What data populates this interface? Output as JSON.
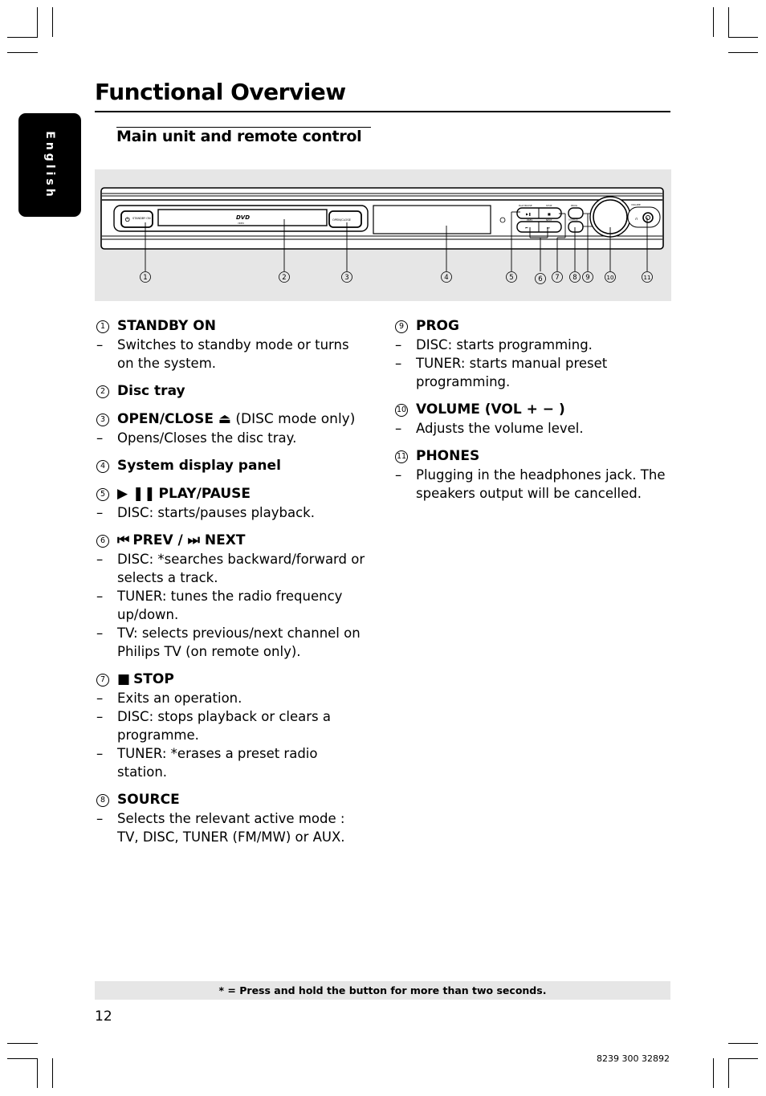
{
  "page": {
    "title": "Functional Overview",
    "subtitle": "Main unit and remote control",
    "language_tab": "English",
    "page_number": "12",
    "document_code": "8239 300 32892",
    "footnote": "* = Press and hold the button for more than two seconds."
  },
  "figure": {
    "device_labels": {
      "standby": "STANDBY ON",
      "dvd_logo": "DVD",
      "dvd_sub": "VIDEO",
      "open_close": "OPEN/CLOSE",
      "play_pause": "PLAY/PAUSE",
      "stop": "STOP",
      "prev": "PREV",
      "next": "NEXT",
      "prog": "PROG",
      "source": "SOURCE",
      "volume": "VOLUME"
    },
    "callouts": [
      "1",
      "2",
      "3",
      "4",
      "5",
      "6",
      "7",
      "8",
      "9",
      "10",
      "11"
    ]
  },
  "items_left": [
    {
      "num": "1",
      "symbol": "",
      "title": "STANDBY ON",
      "mode": "",
      "desc": [
        "Switches to standby mode or turns on the system."
      ]
    },
    {
      "num": "2",
      "symbol": "",
      "title": "Disc tray",
      "mode": "",
      "desc": []
    },
    {
      "num": "3",
      "symbol": "",
      "title": "OPEN/CLOSE ⏏",
      "mode": " (DISC mode only)",
      "desc": [
        "Opens/Closes the disc tray."
      ]
    },
    {
      "num": "4",
      "symbol": "",
      "title": "System display panel",
      "mode": "",
      "desc": []
    },
    {
      "num": "5",
      "symbol": "▶ ❚❚",
      "title": "PLAY/PAUSE",
      "mode": "",
      "desc": [
        "DISC: starts/pauses playback."
      ]
    },
    {
      "num": "6",
      "symbol": "⏮",
      "title": "PREV / ⏭ NEXT",
      "mode": "",
      "desc": [
        "DISC: *searches backward/forward or selects a track.",
        "TUNER: tunes the radio frequency up/down.",
        "TV: selects previous/next channel on Philips TV (on remote only)."
      ]
    },
    {
      "num": "7",
      "symbol": "■",
      "title": "STOP",
      "mode": "",
      "desc": [
        "Exits an operation.",
        "DISC: stops playback or clears a programme.",
        "TUNER: *erases a preset radio station."
      ]
    },
    {
      "num": "8",
      "symbol": "",
      "title": "SOURCE",
      "mode": "",
      "desc": [
        "Selects the relevant active mode : TV, DISC, TUNER (FM/MW) or AUX."
      ]
    }
  ],
  "items_right": [
    {
      "num": "9",
      "symbol": "",
      "title": "PROG",
      "mode": "",
      "desc": [
        "DISC: starts programming.",
        "TUNER: starts manual preset programming."
      ]
    },
    {
      "num": "10",
      "symbol": "",
      "title": "VOLUME (VOL + − )",
      "mode": "",
      "desc": [
        "Adjusts the volume level."
      ]
    },
    {
      "num": "11",
      "symbol": "",
      "title": "PHONES",
      "mode": "",
      "desc": [
        "Plugging in the headphones jack. The speakers output will be cancelled."
      ]
    }
  ]
}
